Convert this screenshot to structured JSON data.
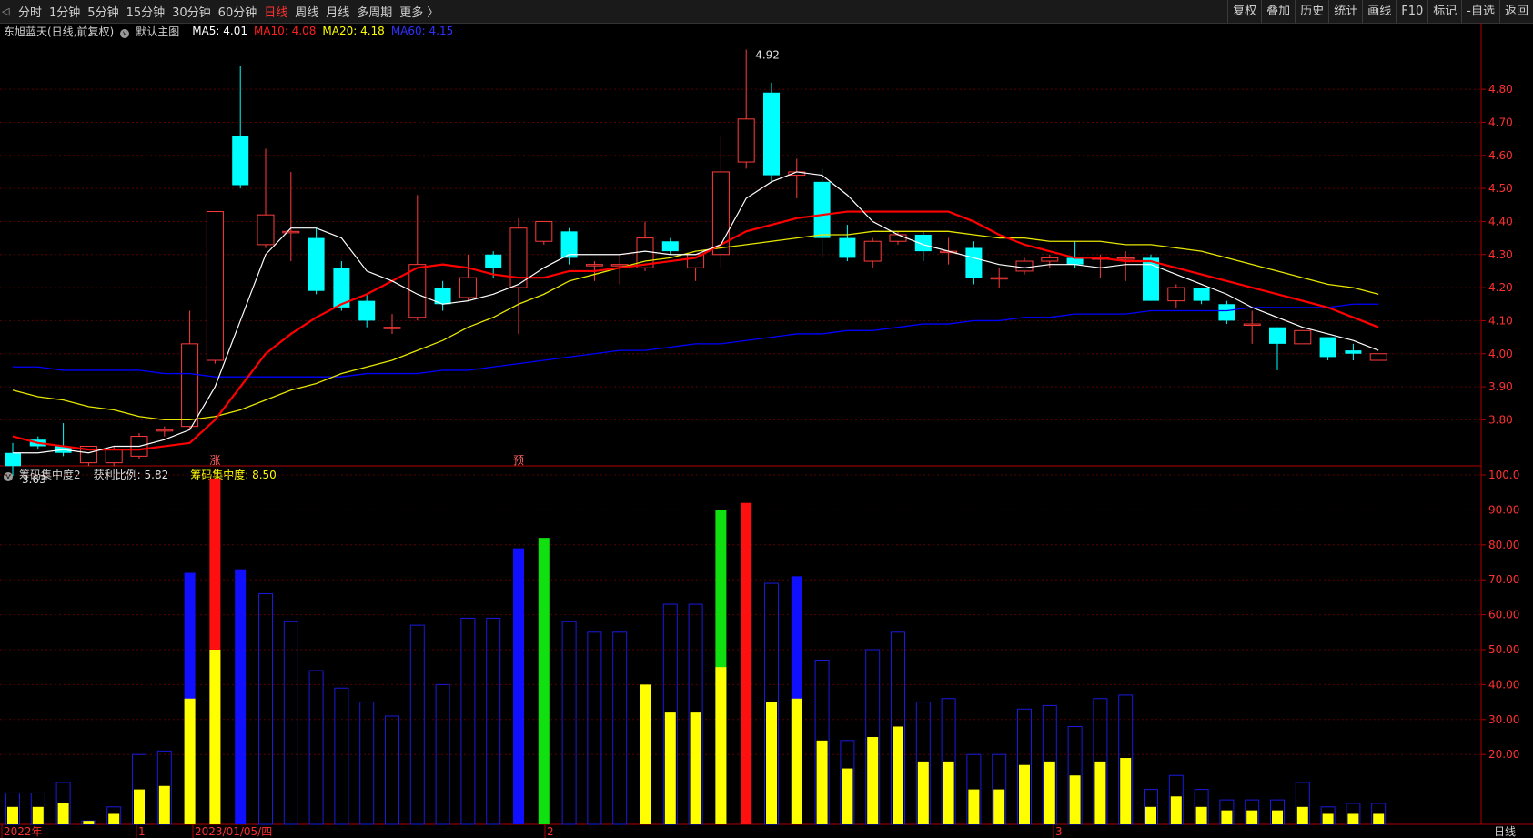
{
  "toolbar": {
    "periods": [
      "分时",
      "1分钟",
      "5分钟",
      "15分钟",
      "30分钟",
      "60分钟",
      "日线",
      "周线",
      "月线",
      "多周期",
      "更多 〉"
    ],
    "active": "日线",
    "actions": [
      "复权",
      "叠加",
      "历史",
      "统计",
      "画线",
      "F10",
      "标记",
      "-自选",
      "返回"
    ]
  },
  "main_legend": {
    "stock": "东旭蓝天(日线,前复权)",
    "indicator": "默认主图",
    "ma5": "MA5: 4.01",
    "ma10": "MA10: 4.08",
    "ma20": "MA20: 4.18",
    "ma60": "MA60: 4.15"
  },
  "sub_legend": {
    "name": "筹码集中度2",
    "profit": "获利比例: 5.82",
    "conc": "筹码集中度: 8.50"
  },
  "markers": {
    "zhang": "涨",
    "yu": "预"
  },
  "period_label": "日线",
  "colors": {
    "up": "#ff3b3b",
    "down": "#00ffff",
    "ma5": "#ffffff",
    "ma10": "#ff0000",
    "ma20": "#e6e600",
    "ma60": "#0000ff",
    "grid": "#5a0000",
    "axis": "#b00000"
  },
  "chart_data": [
    {
      "type": "candlestick",
      "y_ticks": [
        "4.80",
        "4.70",
        "4.60",
        "4.50",
        "4.40",
        "4.30",
        "4.20",
        "4.10",
        "4.00",
        "3.90",
        "3.80"
      ],
      "ylim": [
        3.68,
        4.96
      ],
      "high_label": "4.92",
      "low_label": "3.63",
      "candles": [
        [
          3.7,
          3.66,
          3.73,
          3.63
        ],
        [
          3.74,
          3.72,
          3.75,
          3.71
        ],
        [
          3.72,
          3.7,
          3.79,
          3.69
        ],
        [
          3.67,
          3.72,
          3.72,
          3.66
        ],
        [
          3.67,
          3.71,
          3.72,
          3.66
        ],
        [
          3.69,
          3.75,
          3.76,
          3.68
        ],
        [
          3.77,
          3.77,
          3.78,
          3.75
        ],
        [
          3.78,
          4.03,
          4.13,
          3.77
        ],
        [
          3.98,
          4.43,
          4.43,
          3.97
        ],
        [
          4.66,
          4.51,
          4.87,
          4.5
        ],
        [
          4.33,
          4.42,
          4.62,
          4.32
        ],
        [
          4.37,
          4.37,
          4.55,
          4.28
        ],
        [
          4.35,
          4.19,
          4.38,
          4.18
        ],
        [
          4.26,
          4.14,
          4.28,
          4.13
        ],
        [
          4.16,
          4.1,
          4.18,
          4.08
        ],
        [
          4.08,
          4.08,
          4.12,
          4.06
        ],
        [
          4.11,
          4.27,
          4.48,
          4.1
        ],
        [
          4.2,
          4.15,
          4.22,
          4.13
        ],
        [
          4.17,
          4.23,
          4.3,
          4.16
        ],
        [
          4.3,
          4.26,
          4.31,
          4.23
        ],
        [
          4.2,
          4.38,
          4.41,
          4.06
        ],
        [
          4.34,
          4.4,
          4.4,
          4.33
        ],
        [
          4.37,
          4.29,
          4.38,
          4.27
        ],
        [
          4.27,
          4.27,
          4.28,
          4.22
        ],
        [
          4.27,
          4.27,
          4.3,
          4.21
        ],
        [
          4.26,
          4.35,
          4.4,
          4.25
        ],
        [
          4.34,
          4.31,
          4.35,
          4.3
        ],
        [
          4.26,
          4.3,
          4.3,
          4.22
        ],
        [
          4.3,
          4.55,
          4.66,
          4.26
        ],
        [
          4.58,
          4.71,
          4.92,
          4.56
        ],
        [
          4.79,
          4.54,
          4.82,
          4.52
        ],
        [
          4.54,
          4.55,
          4.59,
          4.47
        ],
        [
          4.52,
          4.35,
          4.56,
          4.29
        ],
        [
          4.35,
          4.29,
          4.39,
          4.28
        ],
        [
          4.28,
          4.34,
          4.35,
          4.26
        ],
        [
          4.34,
          4.36,
          4.37,
          4.33
        ],
        [
          4.36,
          4.31,
          4.37,
          4.28
        ],
        [
          4.31,
          4.31,
          4.35,
          4.27
        ],
        [
          4.32,
          4.23,
          4.34,
          4.21
        ],
        [
          4.23,
          4.23,
          4.26,
          4.2
        ],
        [
          4.25,
          4.28,
          4.29,
          4.24
        ],
        [
          4.28,
          4.29,
          4.3,
          4.26
        ],
        [
          4.29,
          4.27,
          4.34,
          4.26
        ],
        [
          4.29,
          4.29,
          4.3,
          4.23
        ],
        [
          4.29,
          4.29,
          4.31,
          4.22
        ],
        [
          4.29,
          4.16,
          4.3,
          4.16
        ],
        [
          4.16,
          4.2,
          4.21,
          4.14
        ],
        [
          4.2,
          4.16,
          4.2,
          4.15
        ],
        [
          4.15,
          4.1,
          4.16,
          4.09
        ],
        [
          4.09,
          4.09,
          4.13,
          4.03
        ],
        [
          4.08,
          4.03,
          4.08,
          3.95
        ],
        [
          4.03,
          4.07,
          4.07,
          4.03
        ],
        [
          4.05,
          3.99,
          4.05,
          3.98
        ],
        [
          4.01,
          4.0,
          4.03,
          3.98
        ],
        [
          3.98,
          4.0,
          4.0,
          3.98
        ]
      ],
      "ma5": [
        3.7,
        3.7,
        3.71,
        3.7,
        3.72,
        3.72,
        3.74,
        3.77,
        3.9,
        4.1,
        4.3,
        4.38,
        4.38,
        4.35,
        4.25,
        4.22,
        4.18,
        4.15,
        4.16,
        4.18,
        4.21,
        4.26,
        4.3,
        4.3,
        4.3,
        4.31,
        4.3,
        4.3,
        4.33,
        4.47,
        4.52,
        4.55,
        4.54,
        4.48,
        4.4,
        4.36,
        4.33,
        4.31,
        4.29,
        4.27,
        4.26,
        4.27,
        4.27,
        4.26,
        4.27,
        4.27,
        4.24,
        4.21,
        4.18,
        4.14,
        4.11,
        4.08,
        4.06,
        4.04,
        4.01
      ],
      "ma10": [
        3.75,
        3.73,
        3.72,
        3.71,
        3.71,
        3.71,
        3.72,
        3.73,
        3.8,
        3.9,
        4.0,
        4.06,
        4.11,
        4.15,
        4.18,
        4.22,
        4.26,
        4.27,
        4.26,
        4.24,
        4.23,
        4.23,
        4.25,
        4.25,
        4.26,
        4.27,
        4.28,
        4.29,
        4.33,
        4.37,
        4.39,
        4.41,
        4.42,
        4.43,
        4.43,
        4.43,
        4.43,
        4.43,
        4.4,
        4.36,
        4.33,
        4.31,
        4.29,
        4.29,
        4.28,
        4.28,
        4.26,
        4.24,
        4.22,
        4.2,
        4.18,
        4.16,
        4.14,
        4.11,
        4.08
      ],
      "ma20": [
        3.89,
        3.87,
        3.86,
        3.84,
        3.83,
        3.81,
        3.8,
        3.8,
        3.81,
        3.83,
        3.86,
        3.89,
        3.91,
        3.94,
        3.96,
        3.98,
        4.01,
        4.04,
        4.08,
        4.11,
        4.15,
        4.18,
        4.22,
        4.24,
        4.26,
        4.28,
        4.29,
        4.31,
        4.32,
        4.33,
        4.34,
        4.35,
        4.36,
        4.36,
        4.37,
        4.37,
        4.37,
        4.37,
        4.36,
        4.35,
        4.35,
        4.34,
        4.34,
        4.34,
        4.33,
        4.33,
        4.32,
        4.31,
        4.29,
        4.27,
        4.25,
        4.23,
        4.21,
        4.2,
        4.18
      ],
      "ma60": [
        3.96,
        3.96,
        3.95,
        3.95,
        3.95,
        3.95,
        3.94,
        3.94,
        3.93,
        3.93,
        3.93,
        3.93,
        3.93,
        3.93,
        3.94,
        3.94,
        3.94,
        3.95,
        3.95,
        3.96,
        3.97,
        3.98,
        3.99,
        4.0,
        4.01,
        4.01,
        4.02,
        4.03,
        4.03,
        4.04,
        4.05,
        4.06,
        4.06,
        4.07,
        4.07,
        4.08,
        4.09,
        4.09,
        4.1,
        4.1,
        4.11,
        4.11,
        4.12,
        4.12,
        4.12,
        4.13,
        4.13,
        4.13,
        4.13,
        4.14,
        4.14,
        4.14,
        4.14,
        4.15,
        4.15
      ],
      "markers": [
        {
          "index": 8,
          "text": "涨"
        },
        {
          "index": 20,
          "text": "预"
        }
      ]
    },
    {
      "type": "bar",
      "title": "筹码集中度2",
      "y_ticks": [
        "100.0",
        "90.00",
        "80.00",
        "70.00",
        "60.00",
        "50.00",
        "40.00",
        "30.00",
        "20.00"
      ],
      "ylim": [
        0,
        100
      ],
      "outline": [
        9,
        9,
        12,
        1,
        5,
        20,
        21,
        72,
        99,
        73,
        66,
        58,
        44,
        39,
        35,
        31,
        57,
        40,
        59,
        59,
        79,
        82,
        58,
        55,
        55,
        40,
        63,
        63,
        90,
        92,
        69,
        71,
        47,
        24,
        50,
        55,
        35,
        36,
        20,
        20,
        33,
        34,
        28,
        36,
        37,
        10,
        14,
        10,
        7,
        7,
        7,
        12,
        5,
        6,
        6
      ],
      "yellow": [
        5,
        5,
        6,
        1,
        3,
        10,
        11,
        36,
        50,
        0,
        0,
        0,
        0,
        0,
        0,
        0,
        0,
        0,
        0,
        0,
        0,
        0,
        0,
        0,
        0,
        40,
        32,
        32,
        45,
        0,
        35,
        36,
        24,
        16,
        25,
        28,
        18,
        18,
        10,
        10,
        17,
        18,
        14,
        18,
        19,
        5,
        8,
        5,
        4,
        4,
        4,
        5,
        3,
        3,
        3
      ],
      "solid_color": [
        "",
        "",
        "",
        "",
        "",
        "",
        "",
        "blue",
        "red",
        "blue",
        "",
        "",
        "",
        "",
        "",
        "",
        "",
        "",
        "",
        "",
        "blue",
        "green",
        "",
        "",
        "",
        "green",
        "",
        "",
        "green",
        "red",
        "",
        "blue",
        "",
        "",
        "",
        "",
        "",
        "",
        "",
        "",
        "",
        "",
        "",
        "",
        "",
        "",
        "",
        "",
        "",
        "",
        "",
        "",
        "",
        "",
        ""
      ],
      "x_labels": [
        "2022年",
        "1",
        "2023/01/05/四",
        "2",
        "3"
      ]
    }
  ]
}
